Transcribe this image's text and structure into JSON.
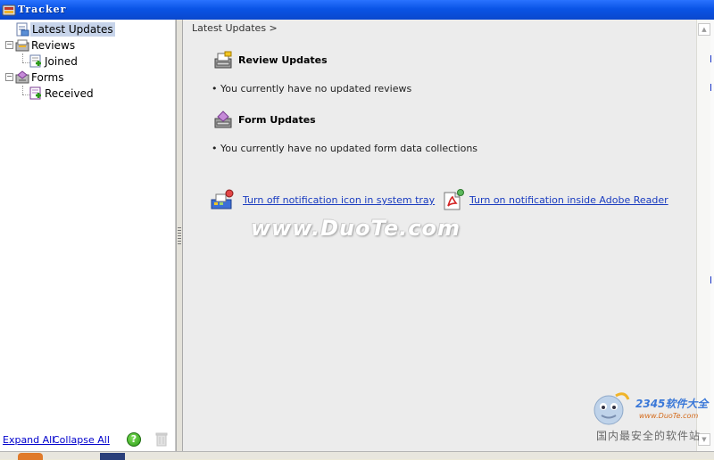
{
  "window": {
    "title": "Tracker"
  },
  "tree": {
    "latest": {
      "label": "Latest Updates"
    },
    "reviews": {
      "label": "Reviews",
      "expander": "−",
      "children": [
        {
          "label": "Joined"
        }
      ]
    },
    "forms": {
      "label": "Forms",
      "expander": "−",
      "children": [
        {
          "label": "Received"
        }
      ]
    }
  },
  "footer": {
    "expand_all": "Expand All",
    "collapse_all": "Collapse All",
    "help_symbol": "?"
  },
  "content": {
    "breadcrumb": "Latest Updates >",
    "review_section": {
      "title": "Review Updates",
      "message": "• You currently have no updated reviews"
    },
    "form_section": {
      "title": "Form Updates",
      "message": "• You currently have no updated form data collections"
    },
    "actions": {
      "tray_link": "Turn off notification icon in system tray",
      "reader_link": "Turn on notification inside Adobe Reader"
    }
  },
  "scrollbar": {
    "up_arrow": "▲",
    "down_arrow": "▼"
  },
  "watermark": {
    "text": "www.DuoTe.com",
    "corner_brand": "2345软件大全",
    "corner_url": "www.DuoTe.com",
    "corner_slogan": "国内最安全的软件站"
  },
  "colors": {
    "titlebar": "#0a54e6",
    "link": "#1a3cc0",
    "selection": "#c7d4ea",
    "help_green": "#2a9a16"
  }
}
